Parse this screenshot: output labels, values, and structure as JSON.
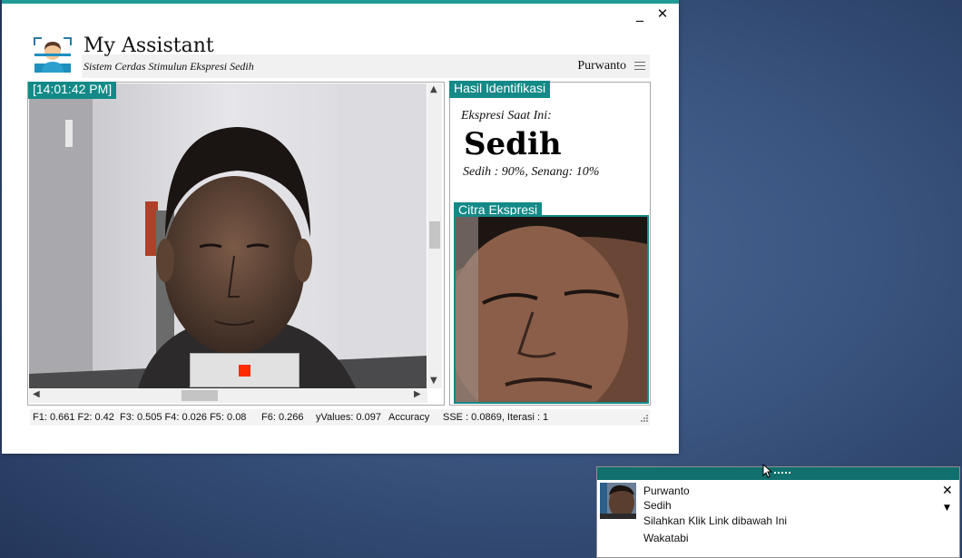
{
  "window": {
    "minimize_glyph": "_",
    "close_glyph": "✕",
    "title": "My Assistant",
    "subtitle": "Sistem Cerdas Stimulun Ekspresi Sedih",
    "user": "Purwanto",
    "menu_icon": "hamburger-icon",
    "accent_color": "#138a87"
  },
  "camera": {
    "timestamp": "[14:01:42 PM]",
    "stop_icon": "stop-square-icon",
    "stop_color": "#ff2a00"
  },
  "result": {
    "title": "Hasil Identifikasi",
    "current_label": "Ekspresi Saat Ini:",
    "expression": "Sedih",
    "probabilities": "Sedih : 90%, Senang: 10%",
    "image_title": "Citra Ekspresi"
  },
  "status": {
    "f1_f2": "F1: 0.661 F2: 0.42",
    "f3_f5": "F3: 0.505 F4: 0.026 F5: 0.08",
    "f6": "F6: 0.266",
    "yvalues": "yValues: 0.097",
    "accuracy": "Accuracy",
    "sse": "SSE : 0.0869, Iterasi : 1"
  },
  "notification": {
    "name": "Purwanto",
    "expression": "Sedih",
    "message": "Silahkan Klik Link dibawah Ini",
    "link": "Wakatabi",
    "close_glyph": "✕",
    "dropdown_glyph": "▼"
  }
}
